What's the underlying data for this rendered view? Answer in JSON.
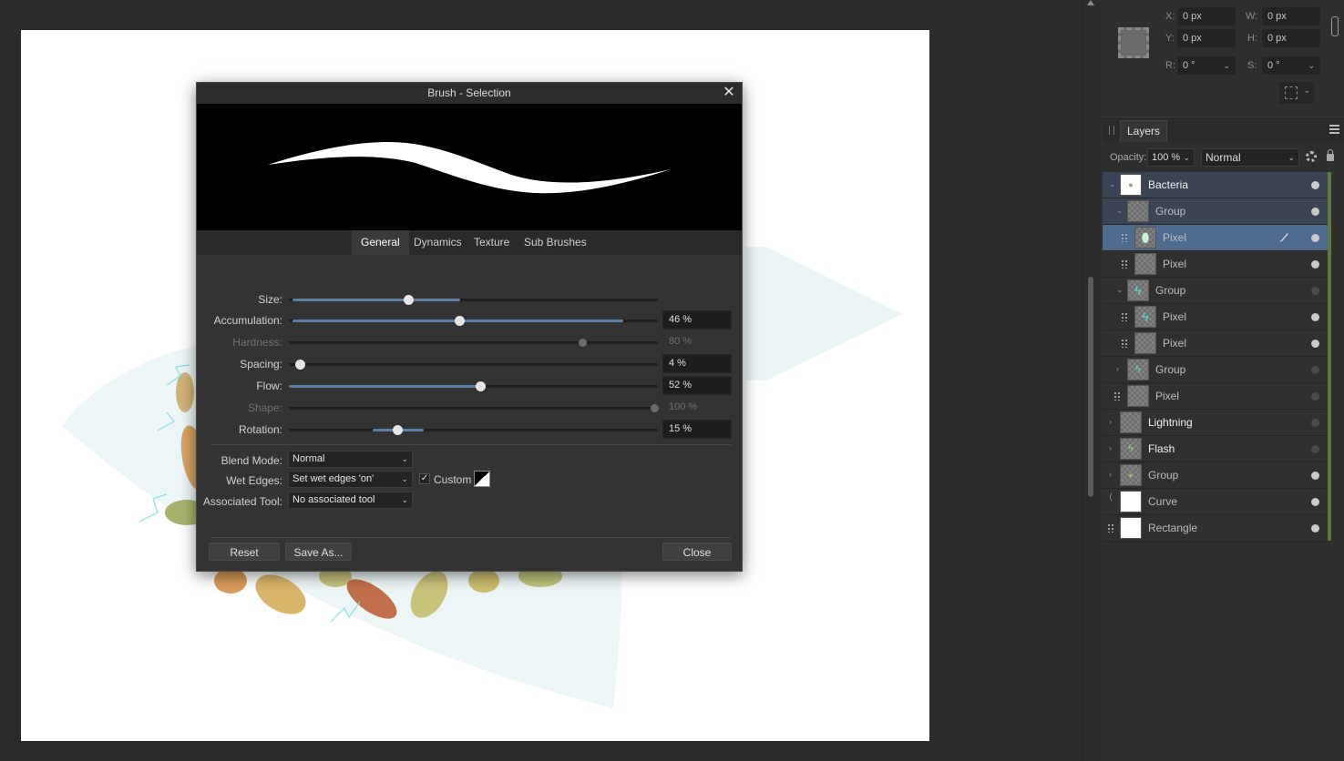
{
  "transform": {
    "x_label": "X:",
    "x_value": "0 px",
    "y_label": "Y:",
    "y_value": "0 px",
    "w_label": "W:",
    "w_value": "0 px",
    "h_label": "H:",
    "h_value": "0 px",
    "r_label": "R:",
    "r_value": "0 °",
    "s_label": "S:",
    "s_value": "0 °"
  },
  "layers_panel": {
    "tab_label": "Layers",
    "opacity_label": "Opacity:",
    "opacity_value": "100 %",
    "blend_mode": "Normal",
    "layers": [
      {
        "name": "Bacteria",
        "state": "sel-parent",
        "bright": true,
        "visible": true
      },
      {
        "name": "Group",
        "state": "sel-parent",
        "bright": false,
        "visible": true
      },
      {
        "name": "Pixel",
        "state": "sel",
        "bright": false,
        "visible": true
      },
      {
        "name": "Pixel",
        "state": "",
        "bright": false,
        "visible": true
      },
      {
        "name": "Group",
        "state": "",
        "bright": false,
        "visible": false
      },
      {
        "name": "Pixel",
        "state": "",
        "bright": false,
        "visible": true
      },
      {
        "name": "Pixel",
        "state": "",
        "bright": false,
        "visible": true
      },
      {
        "name": "Group",
        "state": "",
        "bright": false,
        "visible": false
      },
      {
        "name": "Pixel",
        "state": "",
        "bright": false,
        "visible": false
      },
      {
        "name": "Lightning",
        "state": "",
        "bright": true,
        "visible": false
      },
      {
        "name": "Flash",
        "state": "",
        "bright": true,
        "visible": false
      },
      {
        "name": "Group",
        "state": "",
        "bright": false,
        "visible": true
      },
      {
        "name": "Curve",
        "state": "",
        "bright": false,
        "visible": true
      },
      {
        "name": "Rectangle",
        "state": "",
        "bright": false,
        "visible": true
      }
    ]
  },
  "dialog": {
    "title": "Brush - Selection",
    "close_glyph": "✕",
    "tabs": [
      "General",
      "Dynamics",
      "Texture",
      "Sub Brushes"
    ],
    "active_tab": "General",
    "sliders": [
      {
        "label": "Size:",
        "value": "",
        "fraction": 0.32,
        "enabled": true
      },
      {
        "label": "Accumulation:",
        "value": "46 %",
        "fraction": 0.46,
        "enabled": true
      },
      {
        "label": "Hardness:",
        "value": "80 %",
        "fraction": 0.8,
        "enabled": false
      },
      {
        "label": "Spacing:",
        "value": "4 %",
        "fraction": 0.02,
        "enabled": true
      },
      {
        "label": "Flow:",
        "value": "52 %",
        "fraction": 0.52,
        "enabled": true
      },
      {
        "label": "Shape:",
        "value": "100 %",
        "fraction": 1.0,
        "enabled": false
      },
      {
        "label": "Rotation:",
        "value": "15 %",
        "fraction": 0.29,
        "enabled": true
      }
    ],
    "blend_mode_label": "Blend Mode:",
    "blend_mode_value": "Normal",
    "wet_edges_label": "Wet Edges:",
    "wet_edges_value": "Set wet edges 'on'",
    "custom_checked": true,
    "custom_label": "Custom",
    "associated_tool_label": "Associated Tool:",
    "associated_tool_value": "No associated tool",
    "reset_label": "Reset",
    "save_as_label": "Save As...",
    "close_label": "Close"
  }
}
